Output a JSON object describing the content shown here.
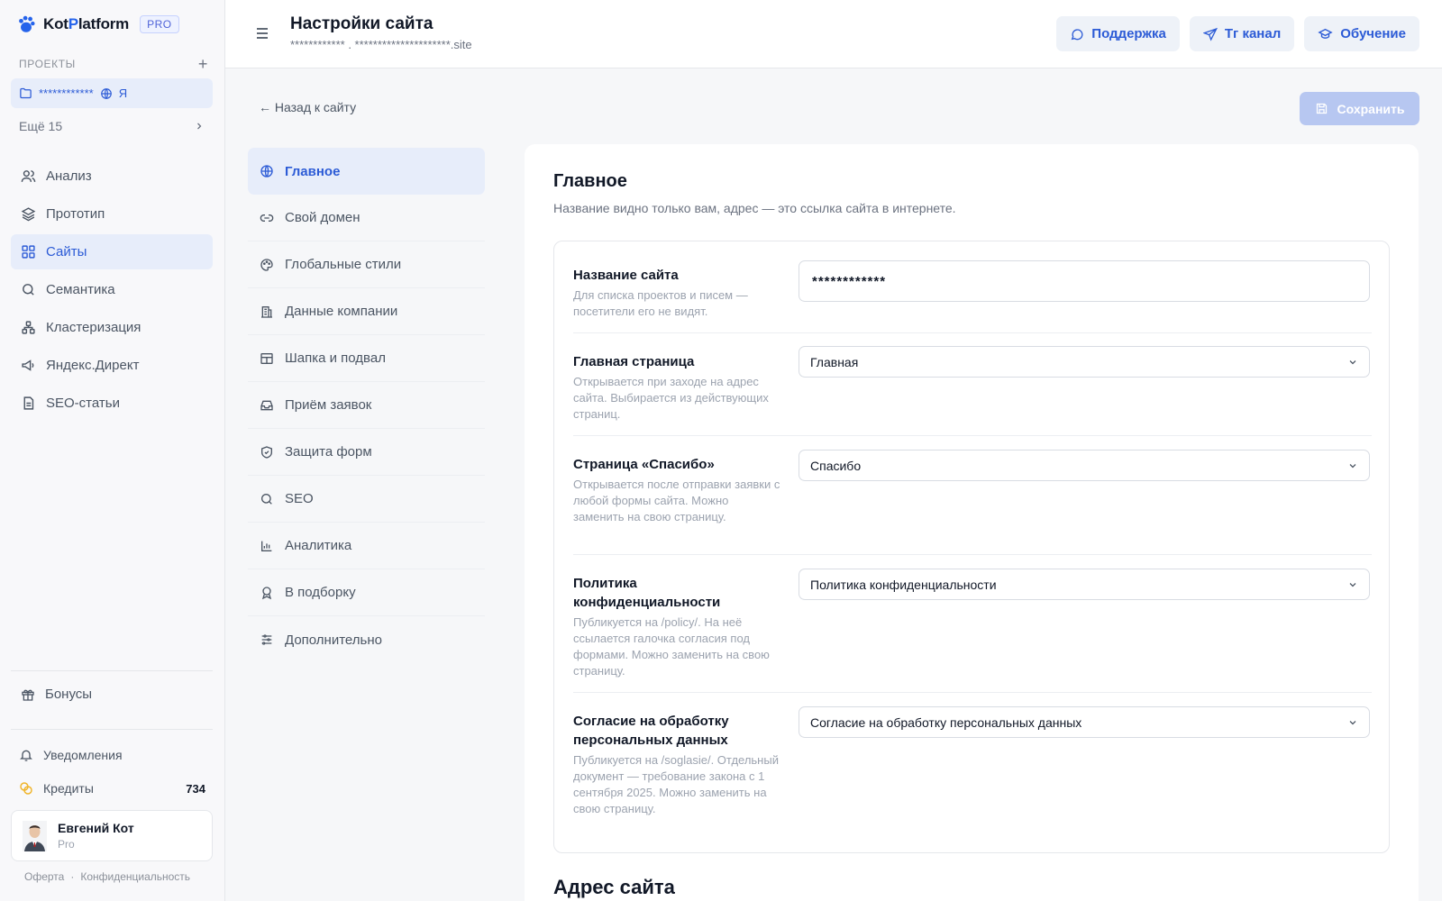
{
  "brand": {
    "name_part1": "Kot",
    "name_accent": "P",
    "name_part2": "latform",
    "badge": "PRO"
  },
  "sidebar": {
    "projects_heading": "ПРОЕКТЫ",
    "add_symbol": "+",
    "current_project": {
      "name": "************",
      "suffix": "Я"
    },
    "more_label": "Ещё 15",
    "nav": [
      {
        "label": "Анализ",
        "icon": "users-icon"
      },
      {
        "label": "Прототип",
        "icon": "layers-icon"
      },
      {
        "label": "Сайты",
        "icon": "grid-icon",
        "active": true
      },
      {
        "label": "Семантика",
        "icon": "search-icon"
      },
      {
        "label": "Кластеризация",
        "icon": "cluster-icon"
      },
      {
        "label": "Яндекс.Директ",
        "icon": "megaphone-icon"
      },
      {
        "label": "SEO-статьи",
        "icon": "document-icon"
      }
    ],
    "bonus_label": "Бонусы",
    "notifications_label": "Уведомления",
    "credits_label": "Кредиты",
    "credits_value": "734",
    "user": {
      "name": "Евгений Кот",
      "plan": "Pro"
    },
    "footer": {
      "offer": "Оферта",
      "sep": "·",
      "privacy": "Конфиденциальность"
    }
  },
  "header": {
    "title": "Настройки сайта",
    "subtitle": "************ . *********************.site",
    "buttons": {
      "support": "Поддержка",
      "channel": "Тг канал",
      "learning": "Обучение"
    }
  },
  "content": {
    "back_link": "← Назад к сайту",
    "save_label": "Сохранить",
    "menu": [
      {
        "label": "Главное",
        "icon": "globe-icon",
        "active": true
      },
      {
        "label": "Свой домен",
        "icon": "link-icon"
      },
      {
        "label": "Глобальные стили",
        "icon": "palette-icon"
      },
      {
        "label": "Данные компании",
        "icon": "building-icon"
      },
      {
        "label": "Шапка и подвал",
        "icon": "layout-icon"
      },
      {
        "label": "Приём заявок",
        "icon": "inbox-icon"
      },
      {
        "label": "Защита форм",
        "icon": "shield-icon"
      },
      {
        "label": "SEO",
        "icon": "search-icon"
      },
      {
        "label": "Аналитика",
        "icon": "chart-icon"
      },
      {
        "label": "В подборку",
        "icon": "award-icon"
      },
      {
        "label": "Дополнительно",
        "icon": "sliders-icon"
      }
    ],
    "section_title": "Главное",
    "section_desc": "Название видно только вам, адрес — это ссылка сайта в интернете.",
    "fields": {
      "site_name": {
        "label": "Название сайта",
        "hint": "Для списка проектов и писем — посетители его не видят.",
        "value": "************"
      },
      "home_page": {
        "label": "Главная страница",
        "hint": "Открывается при заходе на адрес сайта. Выбирается из действующих страниц.",
        "value": "Главная"
      },
      "thanks_page": {
        "label": "Страница «Спасибо»",
        "hint": "Открывается после отправки заявки с любой формы сайта. Можно заменить на свою страницу.",
        "value": "Спасибо"
      },
      "privacy": {
        "label": "Политика конфиденциальности",
        "hint": "Публикуется на /policy/. На неё ссылается галочка согласия под формами. Можно заменить на свою страницу.",
        "value": "Политика конфиденциальности"
      },
      "consent": {
        "label": "Согласие на обработку персональных данных",
        "hint": "Публикуется на /soglasie/. Отдельный документ — требование закона с 1 сентября 2025. Можно заменить на свою страницу.",
        "value": "Согласие на обработку персональных данных"
      }
    },
    "next_section_title": "Адрес сайта"
  },
  "colors": {
    "accent": "#2c5bd6",
    "active_bg": "#e7edfa",
    "save_disabled": "#b7c7f1",
    "coin": "#f0b429"
  }
}
